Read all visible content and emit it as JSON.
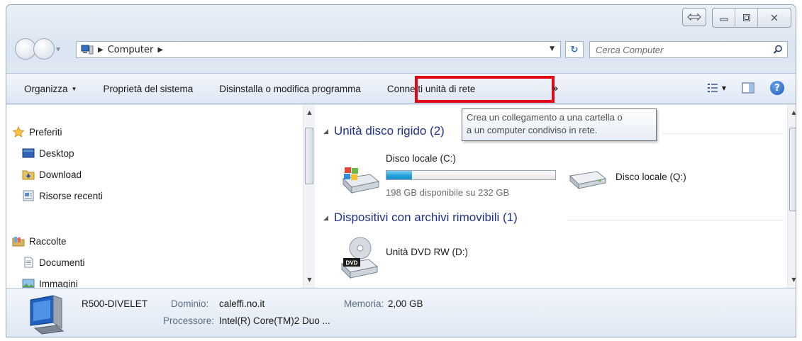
{
  "window": {
    "caption_buttons": [
      "restore-arrows-icon",
      "minimize-icon",
      "maximize-icon",
      "close-icon"
    ]
  },
  "address": {
    "crumbs": [
      "Computer"
    ],
    "search_placeholder": "Cerca Computer"
  },
  "toolbar": {
    "organize": "Organizza",
    "system_properties": "Proprietà del sistema",
    "uninstall": "Disinstalla o modifica programma",
    "map_drive": "Connetti unità di rete",
    "more": "»"
  },
  "tooltip": {
    "line1": "Crea un collegamento a una cartella o",
    "line2": "a un computer condiviso in rete."
  },
  "nav": {
    "favorites": "Preferiti",
    "desktop": "Desktop",
    "download": "Download",
    "recent": "Risorse recenti",
    "libraries": "Raccolte",
    "documents": "Documenti",
    "images": "Immagini"
  },
  "main": {
    "hdd_group": "Unità disco rigido (2)",
    "removable_group": "Dispositivi con archivi rimovibili (1)",
    "drives": [
      {
        "name": "Disco locale (C:)",
        "free_text": "198 GB disponibile su 232 GB",
        "used_fraction": 0.15
      },
      {
        "name": "Disco locale (Q:)"
      },
      {
        "name": "Unità DVD RW (D:)",
        "badge": "DVD"
      }
    ]
  },
  "details": {
    "computer_name": "R500-DIVELET",
    "domain_label": "Dominio:",
    "domain_value": "caleffi.no.it",
    "memory_label": "Memoria:",
    "memory_value": "2,00 GB",
    "cpu_label": "Processore:",
    "cpu_value": "Intel(R) Core(TM)2 Duo ..."
  },
  "colors": {
    "highlight": "#e30613",
    "group_header": "#1e3287",
    "progress": "#26a0da"
  }
}
